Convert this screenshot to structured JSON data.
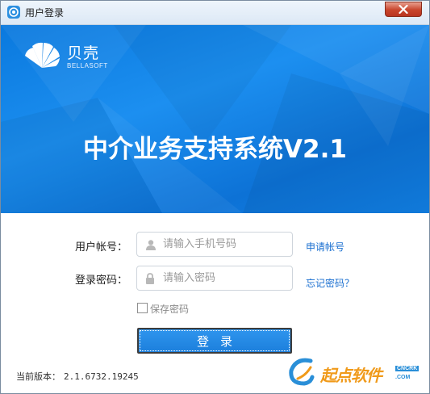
{
  "window": {
    "title": "用户登录",
    "close_icon": "close-icon"
  },
  "banner": {
    "logo_cn": "贝壳",
    "logo_en": "BELLASOFT",
    "title": "中介业务支持系统V2.1",
    "background_color": "#1184e6"
  },
  "form": {
    "account_label": "用户帐号：",
    "account_placeholder": "请输入手机号码",
    "account_value": "",
    "account_icon": "user-icon",
    "password_label": "登录密码：",
    "password_placeholder": "请输入密码",
    "password_value": "",
    "password_icon": "lock-icon",
    "register_link": "申请帐号",
    "forgot_link": "忘记密码？",
    "remember_label": "保存密码",
    "remember_checked": false,
    "login_button": "登录"
  },
  "footer": {
    "version_label": "当前版本：",
    "version_value": "2.1.6732.19245"
  },
  "watermark": {
    "text": "起点软件",
    "badge": "CNCRK",
    "sub": ".COM"
  },
  "colors": {
    "accent": "#1c7fdc",
    "link": "#1a6fd0",
    "close_button": "#c8442b"
  }
}
